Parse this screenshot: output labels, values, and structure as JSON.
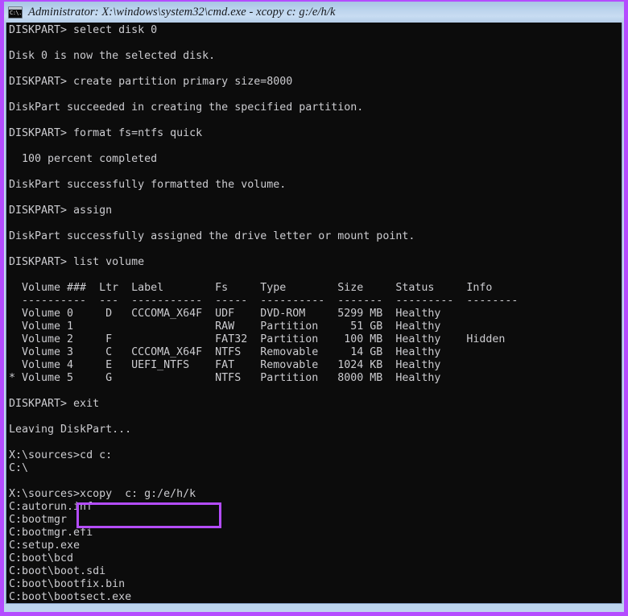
{
  "window": {
    "title": "Administrator: X:\\windows\\system32\\cmd.exe - xcopy  c: g:/e/h/k",
    "icon_name": "cmd-console-icon",
    "icon_glyph": "C:\\.",
    "border_color": "#b44cff",
    "titlebar_color": "#bcd4ed",
    "console_bg": "#0c0c0c",
    "console_fg": "#ccccd0"
  },
  "highlight": {
    "name": "xcopy-command-highlight",
    "color": "#b44cff",
    "target_text": "xcopy  c: g:/e/h/k"
  },
  "console": {
    "lines": [
      "DISKPART> select disk 0",
      "",
      "Disk 0 is now the selected disk.",
      "",
      "DISKPART> create partition primary size=8000",
      "",
      "DiskPart succeeded in creating the specified partition.",
      "",
      "DISKPART> format fs=ntfs quick",
      "",
      "  100 percent completed",
      "",
      "DiskPart successfully formatted the volume.",
      "",
      "DISKPART> assign",
      "",
      "DiskPart successfully assigned the drive letter or mount point.",
      "",
      "DISKPART> list volume",
      "",
      "  Volume ###  Ltr  Label        Fs     Type        Size     Status     Info",
      "  ----------  ---  -----------  -----  ----------  -------  ---------  --------",
      "  Volume 0     D   CCCOMA_X64F  UDF    DVD-ROM     5299 MB  Healthy",
      "  Volume 1                      RAW    Partition     51 GB  Healthy",
      "  Volume 2     F                FAT32  Partition    100 MB  Healthy    Hidden",
      "  Volume 3     C   CCCOMA_X64F  NTFS   Removable     14 GB  Healthy",
      "  Volume 4     E   UEFI_NTFS    FAT    Removable   1024 KB  Healthy",
      "* Volume 5     G                NTFS   Partition   8000 MB  Healthy",
      "",
      "DISKPART> exit",
      "",
      "Leaving DiskPart...",
      "",
      "X:\\sources>cd c:",
      "C:\\",
      "",
      "X:\\sources>xcopy  c: g:/e/h/k",
      "C:autorun.inf",
      "C:bootmgr",
      "C:bootmgr.efi",
      "C:setup.exe",
      "C:boot\\bcd",
      "C:boot\\boot.sdi",
      "C:boot\\bootfix.bin",
      "C:boot\\bootsect.exe"
    ],
    "volume_table": {
      "headers": [
        "Volume ###",
        "Ltr",
        "Label",
        "Fs",
        "Type",
        "Size",
        "Status",
        "Info"
      ],
      "rows": [
        {
          "selected": false,
          "volume": "Volume 0",
          "ltr": "D",
          "label": "CCCOMA_X64F",
          "fs": "UDF",
          "type": "DVD-ROM",
          "size": "5299 MB",
          "status": "Healthy",
          "info": ""
        },
        {
          "selected": false,
          "volume": "Volume 1",
          "ltr": "",
          "label": "",
          "fs": "RAW",
          "type": "Partition",
          "size": "51 GB",
          "status": "Healthy",
          "info": ""
        },
        {
          "selected": false,
          "volume": "Volume 2",
          "ltr": "F",
          "label": "",
          "fs": "FAT32",
          "type": "Partition",
          "size": "100 MB",
          "status": "Healthy",
          "info": "Hidden"
        },
        {
          "selected": false,
          "volume": "Volume 3",
          "ltr": "C",
          "label": "CCCOMA_X64F",
          "fs": "NTFS",
          "type": "Removable",
          "size": "14 GB",
          "status": "Healthy",
          "info": ""
        },
        {
          "selected": false,
          "volume": "Volume 4",
          "ltr": "E",
          "label": "UEFI_NTFS",
          "fs": "FAT",
          "type": "Removable",
          "size": "1024 KB",
          "status": "Healthy",
          "info": ""
        },
        {
          "selected": true,
          "volume": "Volume 5",
          "ltr": "G",
          "label": "",
          "fs": "NTFS",
          "type": "Partition",
          "size": "8000 MB",
          "status": "Healthy",
          "info": ""
        }
      ]
    },
    "commands_entered": [
      "select disk 0",
      "create partition primary size=8000",
      "format fs=ntfs quick",
      "assign",
      "list volume",
      "exit",
      "cd c:",
      "xcopy  c: g:/e/h/k"
    ],
    "copied_files": [
      "C:autorun.inf",
      "C:bootmgr",
      "C:bootmgr.efi",
      "C:setup.exe",
      "C:boot\\bcd",
      "C:boot\\boot.sdi",
      "C:boot\\bootfix.bin",
      "C:boot\\bootsect.exe"
    ]
  }
}
